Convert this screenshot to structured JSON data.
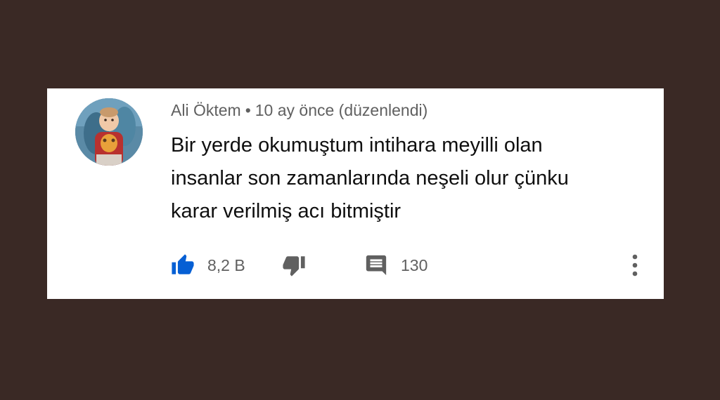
{
  "comment": {
    "author": "Ali Öktem",
    "separator": "•",
    "posted": "10 ay önce (düzenlendi)",
    "text_lines": [
      "Bir yerde okumuştum intihara meyilli olan",
      "insanlar son zamanlarında neşeli olur çünku",
      "karar verilmiş acı bitmiştir"
    ],
    "likes": "8,2 B",
    "replies": "130"
  },
  "icons": {
    "like": "thumbs-up-icon",
    "dislike": "thumbs-down-icon",
    "reply": "comment-icon",
    "more": "more-vertical-icon"
  },
  "colors": {
    "background": "#3a2925",
    "card": "#ffffff",
    "like_active": "#065fd4",
    "muted": "#606060",
    "text": "#0f0f0f"
  }
}
